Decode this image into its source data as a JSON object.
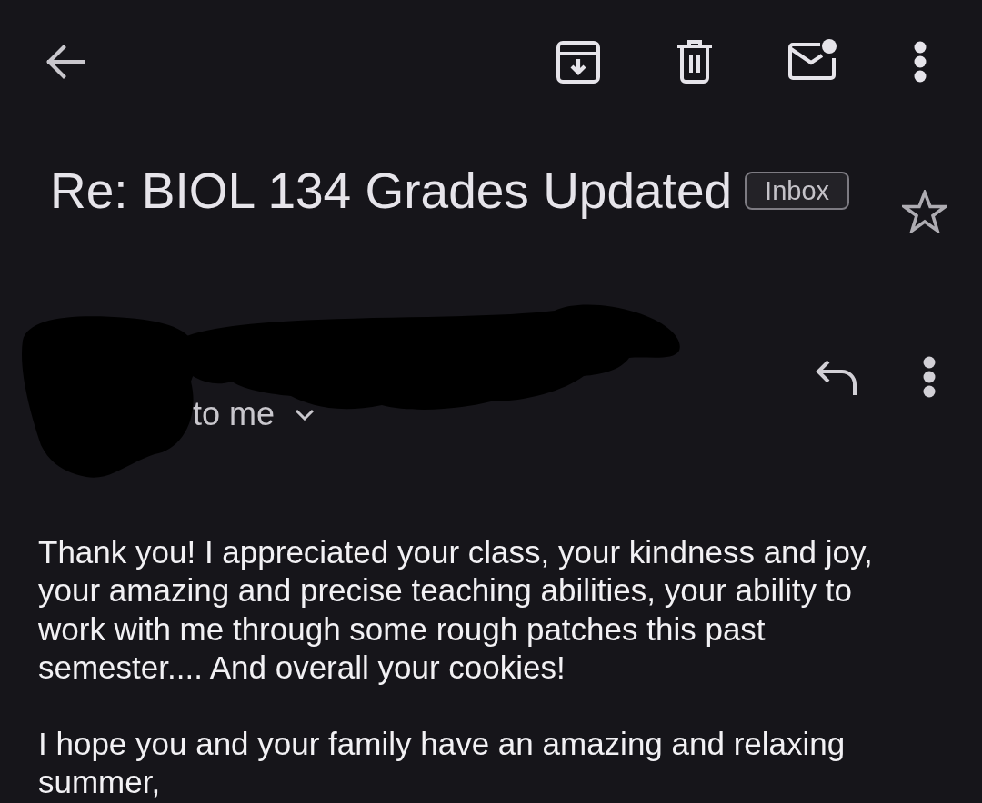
{
  "subject": {
    "title": "Re: BIOL 134 Grades Updated",
    "label": "Inbox",
    "starred": false
  },
  "sender": {
    "recipients": "to me",
    "details_expanded": false
  },
  "body": {
    "paragraphs": [
      "Thank you! I appreciated your class, your kindness and joy, your amazing and precise teaching abilities, your ability to work with me through some rough patches this past semester.... And overall your cookies!",
      "I hope you and your family have an amazing and relaxing summer,"
    ]
  }
}
